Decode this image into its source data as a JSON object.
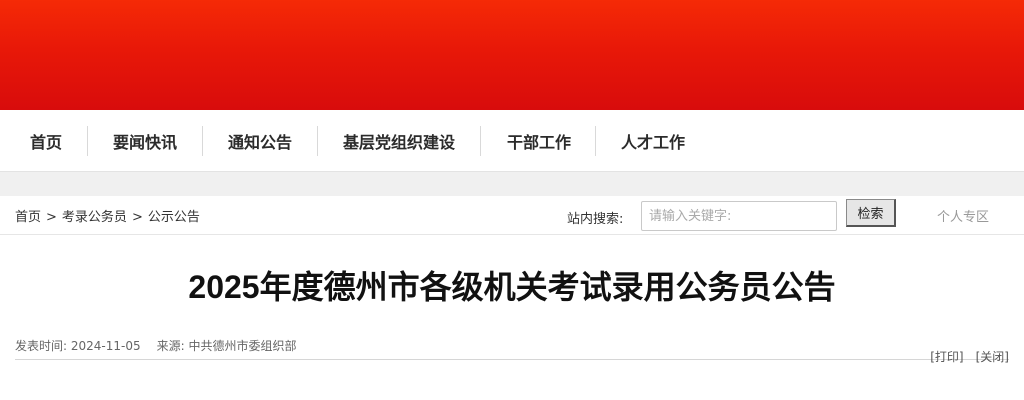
{
  "nav": {
    "items": [
      "首页",
      "要闻快讯",
      "通知公告",
      "基层党组织建设",
      "干部工作",
      "人才工作"
    ]
  },
  "breadcrumb": {
    "items": [
      "首页",
      "考录公务员",
      "公示公告"
    ],
    "separator": ">"
  },
  "search": {
    "label": "站内搜索:",
    "placeholder": "请输入关键字:",
    "button": "检索"
  },
  "personal_zone": "个人专区",
  "article": {
    "title": "2025年度德州市各级机关考试录用公务员公告",
    "publish_label": "发表时间:",
    "publish_date": "2024-11-05",
    "source_label": "来源:",
    "source": "中共德州市委组织部",
    "print": "[打印]",
    "close": "[关闭]"
  },
  "colors": {
    "banner_top": "#f52a06",
    "banner_bottom": "#d80c0c"
  }
}
